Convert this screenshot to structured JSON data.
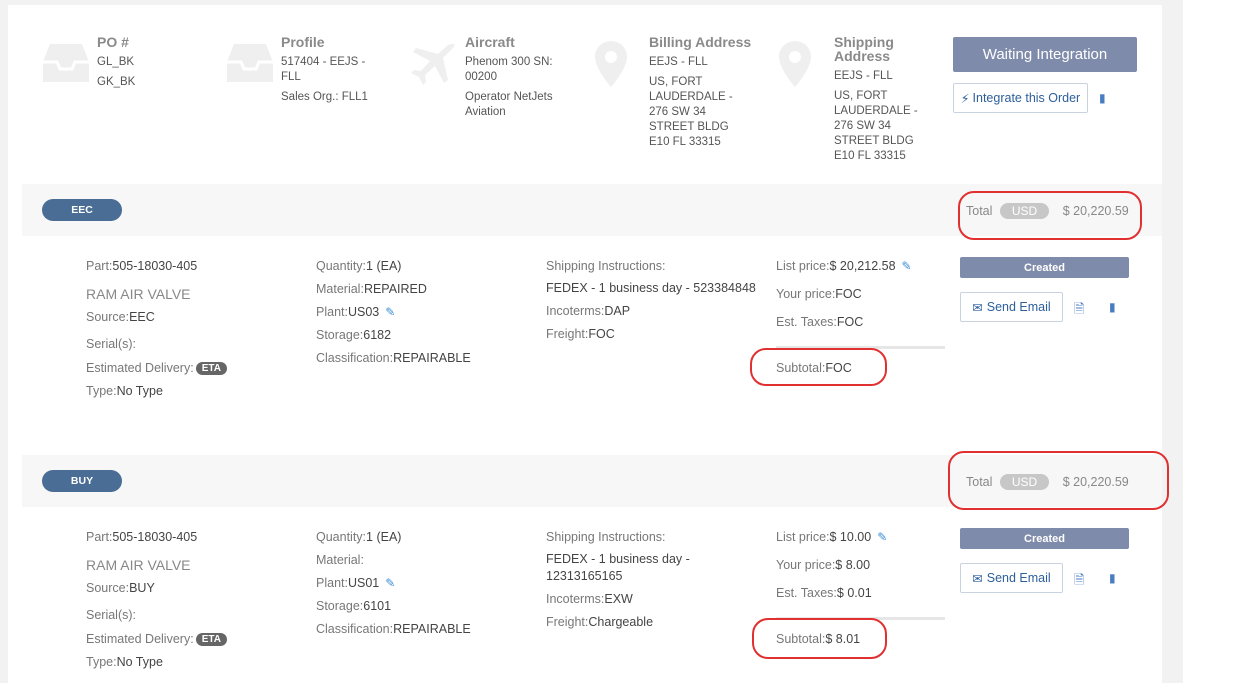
{
  "header": {
    "po": {
      "title": "PO #",
      "lines": [
        "GL_BK",
        "GK_BK"
      ]
    },
    "profile": {
      "title": "Profile",
      "lines": [
        "517404 - EEJS -",
        "FLL",
        "Sales Org.: FLL1"
      ]
    },
    "aircraft": {
      "title": "Aircraft",
      "lines": [
        "Phenom 300 SN:",
        "00200",
        "Operator NetJets",
        "Aviation"
      ]
    },
    "billing": {
      "title": "Billing Address",
      "lines": [
        "EEJS - FLL",
        "US, FORT",
        "LAUDERDALE -",
        "276 SW 34",
        "STREET BLDG",
        "E10 FL 33315"
      ]
    },
    "shipping": {
      "title_line1": "Shipping",
      "title_line2": "Address",
      "lines": [
        "EEJS - FLL",
        "US, FORT",
        "LAUDERDALE -",
        "276 SW 34",
        "STREET BLDG",
        "E10 FL 33315"
      ]
    },
    "status_button": "Waiting Integration",
    "integrate_button": "Integrate this Order"
  },
  "items": [
    {
      "tag": "EEC",
      "total_label": "Total",
      "currency": "USD",
      "total": "$ 20,220.59",
      "part_label": "Part:",
      "part": "505-18030-405",
      "name": "RAM AIR VALVE",
      "source_label": "Source:",
      "source": "EEC",
      "serial_label": "Serial(s):",
      "delivery_label": "Estimated Delivery:",
      "eta": "ETA",
      "type_label": "Type:",
      "type": "No Type",
      "quantity_label": "Quantity:",
      "quantity": "1 (EA)",
      "material_label": "Material:",
      "material": "REPAIRED",
      "plant_label": "Plant:",
      "plant": "US03",
      "storage_label": "Storage:",
      "storage": "6182",
      "classification_label": "Classification:",
      "classification": "REPAIRABLE",
      "shipping_label": "Shipping Instructions:",
      "shipping_line1": "FEDEX - 1 business day - 523384848",
      "shipping_line2": "",
      "incoterms_label": "Incoterms:",
      "incoterms": "DAP",
      "freight_label": "Freight:",
      "freight": "FOC",
      "list_price_label": "List price:",
      "list_price": "$ 20,212.58",
      "your_price_label": "Your price:",
      "your_price": "FOC",
      "taxes_label": "Est. Taxes:",
      "taxes": "FOC",
      "subtotal_label": "Subtotal:",
      "subtotal": "FOC",
      "status": "Created",
      "send_email": "Send Email"
    },
    {
      "tag": "BUY",
      "total_label": "Total",
      "currency": "USD",
      "total": "$ 20,220.59",
      "part_label": "Part:",
      "part": "505-18030-405",
      "name": "RAM AIR VALVE",
      "source_label": "Source:",
      "source": "BUY",
      "serial_label": "Serial(s):",
      "delivery_label": "Estimated Delivery:",
      "eta": "ETA",
      "type_label": "Type:",
      "type": "No Type",
      "quantity_label": "Quantity:",
      "quantity": "1 (EA)",
      "material_label": "Material:",
      "material": "",
      "plant_label": "Plant:",
      "plant": "US01",
      "storage_label": "Storage:",
      "storage": "6101",
      "classification_label": "Classification:",
      "classification": "REPAIRABLE",
      "shipping_label": "Shipping Instructions:",
      "shipping_line1": "FEDEX - 1 business day -",
      "shipping_line2": "12313165165",
      "incoterms_label": "Incoterms:",
      "incoterms": "EXW",
      "freight_label": "Freight:",
      "freight": "Chargeable",
      "list_price_label": "List price:",
      "list_price": "$ 10.00",
      "your_price_label": "Your price:",
      "your_price": "$ 8.00",
      "taxes_label": "Est. Taxes:",
      "taxes": "$ 0.01",
      "subtotal_label": "Subtotal:",
      "subtotal": "$ 8.01",
      "status": "Created",
      "send_email": "Send Email"
    }
  ],
  "colors": {
    "accent": "#7f8bab",
    "pill": "#4a6d95",
    "annotation": "#e03030",
    "link": "#2d5f9b"
  }
}
